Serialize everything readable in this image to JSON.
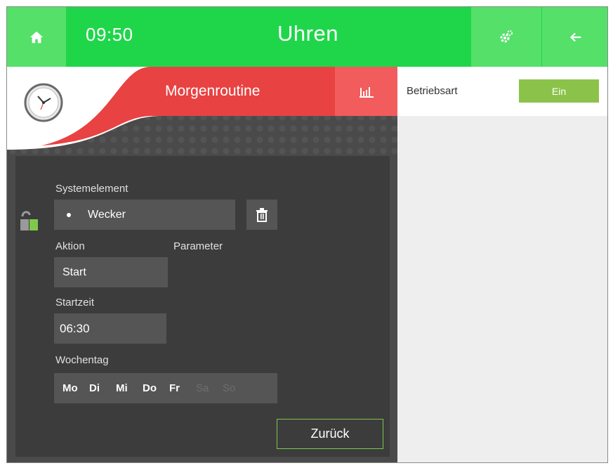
{
  "header": {
    "time": "09:50",
    "title": "Uhren",
    "icons": [
      "home-icon",
      "settings-gear-icon",
      "arrow-left-icon"
    ]
  },
  "banner": {
    "title": "Morgenroutine",
    "icons": [
      "clock-icon",
      "bar-chart-icon"
    ]
  },
  "form": {
    "system_element_label": "Systemelement",
    "system_element_value": "Wecker",
    "action_label": "Aktion",
    "parameter_label": "Parameter",
    "action_value": "Start",
    "start_time_label": "Startzeit",
    "start_time_value": "06:30",
    "weekday_label": "Wochentag",
    "weekdays": [
      {
        "label": "Mo",
        "active": true
      },
      {
        "label": "Di",
        "active": true
      },
      {
        "label": "Mi",
        "active": true
      },
      {
        "label": "Do",
        "active": true
      },
      {
        "label": "Fr",
        "active": true
      },
      {
        "label": "Sa",
        "active": false
      },
      {
        "label": "So",
        "active": false
      }
    ],
    "back_label": "Zurück",
    "icons": [
      "lock-open-icon",
      "trash-icon"
    ]
  },
  "right": {
    "mode_label": "Betriebsart",
    "mode_value": "Ein"
  },
  "colors": {
    "top_bar": "#1fd64a",
    "top_tile": "#55e06a",
    "banner_red": "#e84242",
    "chart_tile": "#f25c5c",
    "panel_dark": "#4a4a4a",
    "field_bg": "#555555",
    "accent_green": "#8bc34a"
  }
}
